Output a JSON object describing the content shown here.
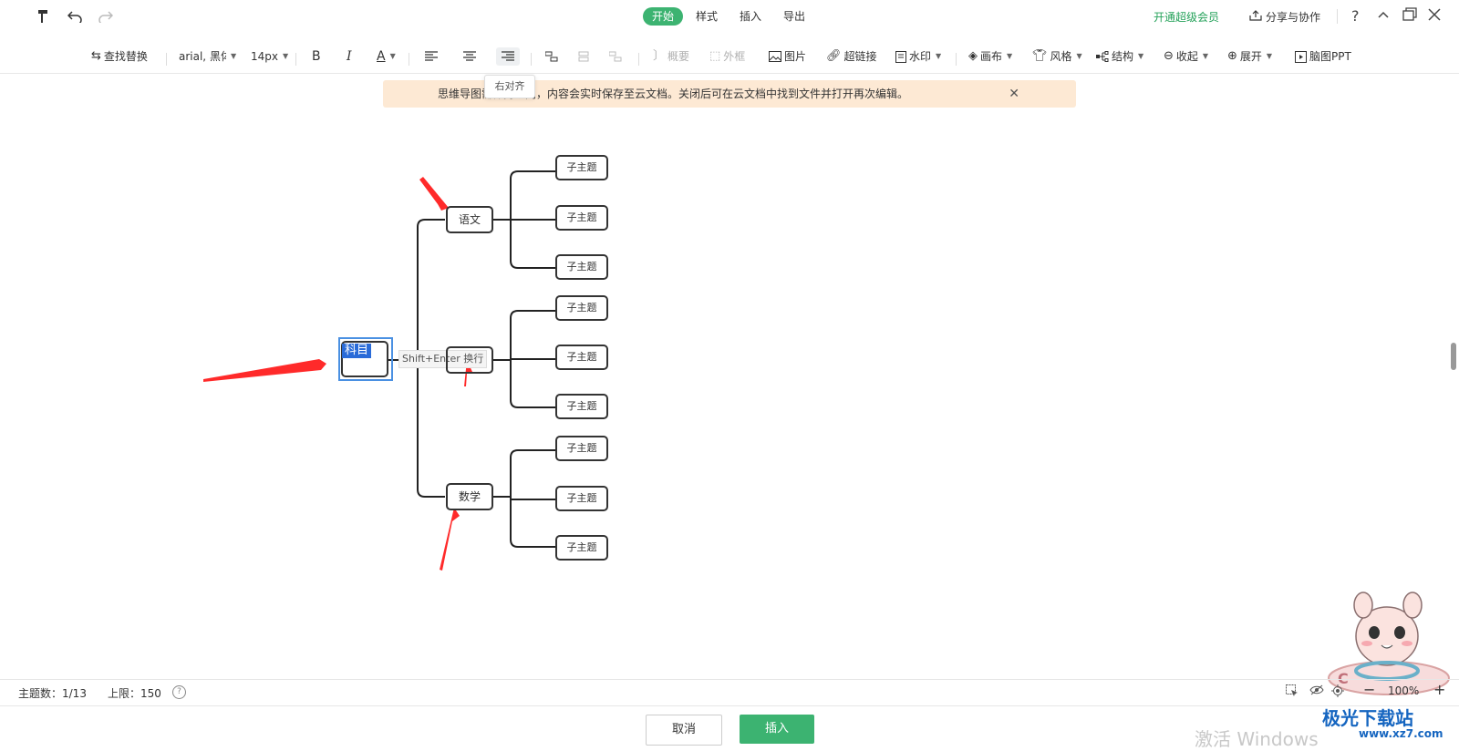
{
  "topbar": {
    "tabs": [
      {
        "label": "开始",
        "active": true
      },
      {
        "label": "样式",
        "active": false
      },
      {
        "label": "插入",
        "active": false
      },
      {
        "label": "导出",
        "active": false
      }
    ],
    "vip_label": "开通超级会员",
    "share_label": "分享与协作",
    "help_glyph": "?"
  },
  "toolbar": {
    "find_replace": "查找替换",
    "font": "arial, 黑体",
    "size": "14px",
    "bold": "B",
    "italic": "I",
    "font_color": "A",
    "summary": "概要",
    "frame": "外框",
    "image": "图片",
    "hyperlink": "超链接",
    "watermark": "水印",
    "canvas": "画布",
    "style": "风格",
    "structure": "结构",
    "collapse": "收起",
    "expand": "展开",
    "ppt": "脑图PPT"
  },
  "tooltip": "右对齐",
  "banner": {
    "text": "思维导图需保持联网，内容会实时保存至云文档。关闭后可在云文档中找到文件并打开再次编辑。",
    "close": "✕"
  },
  "mindmap": {
    "root": "科目",
    "edit_hint": "Shift+Enter 换行",
    "branches": [
      {
        "label": "语文",
        "children": [
          "子主题",
          "子主题",
          "子主题"
        ]
      },
      {
        "label": "",
        "children": [
          "子主题",
          "子主题",
          "子主题"
        ]
      },
      {
        "label": "数学",
        "children": [
          "子主题",
          "子主题",
          "子主题"
        ]
      }
    ]
  },
  "status": {
    "topic_count_label": "主题数：1/13",
    "limit_label": "上限：150",
    "zoom": "100%"
  },
  "footer": {
    "cancel": "取消",
    "insert": "插入"
  },
  "os_watermark": "激活 Windows",
  "site_brand": "极光下载站",
  "site_url": "www.xz7.com",
  "colors": {
    "accent": "#3cb371",
    "banner_bg": "#fde9d4",
    "selection": "#4a90e2",
    "arrow": "#ff2a2a"
  }
}
